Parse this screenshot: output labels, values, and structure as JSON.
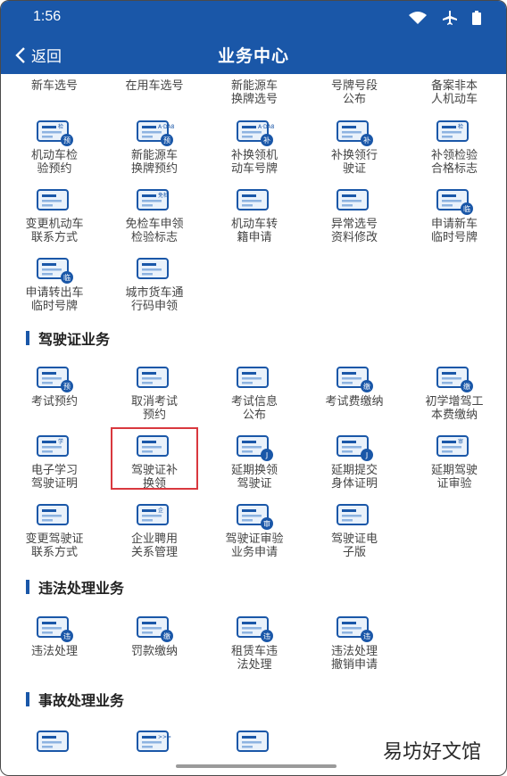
{
  "status_bar": {
    "time": "1:56"
  },
  "nav": {
    "back_label": "返回",
    "title": "业务中心"
  },
  "colors": {
    "brand": "#1a57a8",
    "highlight": "#d9383e"
  },
  "top_row": [
    "新车选号",
    "在用车选号",
    "新能源车\n换牌选号",
    "号牌号段\n公布",
    "备案非本\n人机动车"
  ],
  "vehicle_items": [
    "机动车检\n验预约",
    "新能源车\n换牌预约",
    "补换领机\n动车号牌",
    "补换领行\n驶证",
    "补领检验\n合格标志",
    "变更机动车\n联系方式",
    "免检车申领\n检验标志",
    "机动车转\n籍申请",
    "异常选号\n资料修改",
    "申请新车\n临时号牌",
    "申请转出车\n临时号牌",
    "城市货车通\n行码申领"
  ],
  "vehicle_icons": [
    {
      "name": "inspection-appointment-icon",
      "badge": "预",
      "tag": "检"
    },
    {
      "name": "new-energy-plate-appointment-icon",
      "badge": "预",
      "tag": "A·DA888"
    },
    {
      "name": "replace-plate-icon",
      "badge": "补",
      "tag": "A·DA888"
    },
    {
      "name": "replace-license-icon",
      "badge": "补",
      "tag": ""
    },
    {
      "name": "inspection-mark-icon",
      "badge": "",
      "tag": "检"
    },
    {
      "name": "change-vehicle-contact-icon",
      "badge": "",
      "tag": ""
    },
    {
      "name": "exempt-inspection-icon",
      "badge": "",
      "tag": "免检"
    },
    {
      "name": "vehicle-transfer-icon",
      "badge": "",
      "tag": ""
    },
    {
      "name": "abnormal-plate-edit-icon",
      "badge": "",
      "tag": ""
    },
    {
      "name": "new-car-temp-plate-icon",
      "badge": "临",
      "tag": ""
    },
    {
      "name": "transfer-out-temp-plate-icon",
      "badge": "临",
      "tag": ""
    },
    {
      "name": "truck-pass-icon",
      "badge": "",
      "tag": ""
    }
  ],
  "sections": {
    "license": "驾驶证业务",
    "violation": "违法处理业务",
    "accident": "事故处理业务"
  },
  "license_items": [
    "考试预约",
    "取消考试\n预约",
    "考试信息\n公布",
    "考试费缴纳",
    "初学增驾工\n本费缴纳",
    "电子学习\n驾驶证明",
    "驾驶证补\n换领",
    "延期换领\n驾驶证",
    "延期提交\n身体证明",
    "延期驾驶\n证审验",
    "变更驾驶证\n联系方式",
    "企业聘用\n关系管理",
    "驾驶证审验\n业务申请",
    "驾驶证电\n子版"
  ],
  "license_icons": [
    {
      "name": "exam-appointment-icon",
      "badge": "预",
      "tag": ""
    },
    {
      "name": "cancel-exam-icon",
      "badge": "",
      "tag": ""
    },
    {
      "name": "exam-info-icon",
      "badge": "",
      "tag": ""
    },
    {
      "name": "exam-fee-icon",
      "badge": "缴",
      "tag": ""
    },
    {
      "name": "beginner-fee-icon",
      "badge": "缴",
      "tag": ""
    },
    {
      "name": "e-study-certificate-icon",
      "badge": "",
      "tag": "学"
    },
    {
      "name": "license-replace-icon",
      "badge": "",
      "tag": ""
    },
    {
      "name": "license-extend-icon",
      "badge": "J",
      "tag": ""
    },
    {
      "name": "health-proof-extend-icon",
      "badge": "J",
      "tag": ""
    },
    {
      "name": "license-review-extend-icon",
      "badge": "",
      "tag": "审"
    },
    {
      "name": "change-license-contact-icon",
      "badge": "",
      "tag": ""
    },
    {
      "name": "enterprise-employment-icon",
      "badge": "",
      "tag": "企"
    },
    {
      "name": "license-review-apply-icon",
      "badge": "审",
      "tag": ""
    },
    {
      "name": "e-license-icon",
      "badge": "",
      "tag": ""
    }
  ],
  "violation_items": [
    "违法处理",
    "罚款缴纳",
    "租赁车违\n法处理",
    "违法处理\n撤销申请"
  ],
  "violation_icons": [
    {
      "name": "violation-handle-icon",
      "badge": "违",
      "tag": ""
    },
    {
      "name": "fine-payment-icon",
      "badge": "缴",
      "tag": ""
    },
    {
      "name": "rental-violation-icon",
      "badge": "违",
      "tag": ""
    },
    {
      "name": "violation-revoke-icon",
      "badge": "违",
      "tag": ""
    }
  ],
  "accident_icons": [
    {
      "name": "accident-quick-icon",
      "badge": "",
      "tag": ""
    },
    {
      "name": "accident-handle-icon",
      "badge": "",
      "tag": ">>>"
    },
    {
      "name": "accident-certificate-icon",
      "badge": "",
      "tag": ""
    }
  ],
  "watermark": "易坊好文馆"
}
